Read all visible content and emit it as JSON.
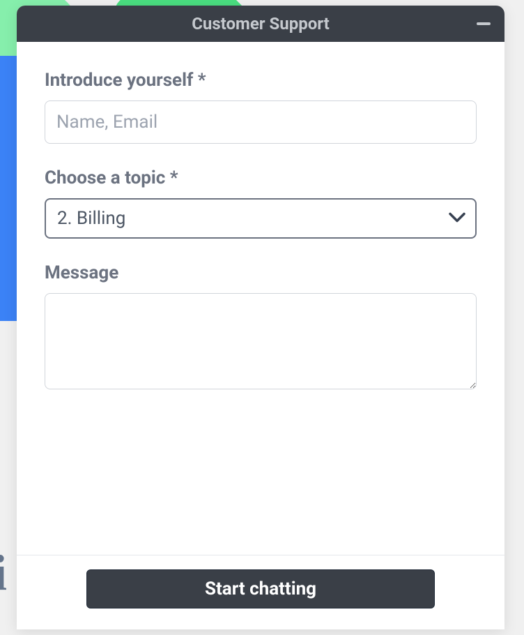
{
  "header": {
    "title": "Customer Support"
  },
  "form": {
    "introduce": {
      "label": "Introduce yourself *",
      "placeholder": "Name, Email",
      "value": ""
    },
    "topic": {
      "label": "Choose a topic *",
      "selected": "2. Billing"
    },
    "message": {
      "label": "Message",
      "value": ""
    }
  },
  "footer": {
    "startButton": "Start chatting"
  }
}
